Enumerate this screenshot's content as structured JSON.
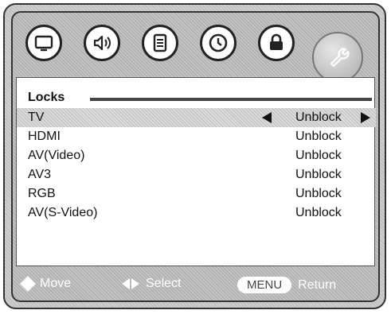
{
  "tabs": [
    {
      "name": "picture-tab",
      "icon": "tv-icon"
    },
    {
      "name": "audio-tab",
      "icon": "speaker-icon"
    },
    {
      "name": "setup-tab",
      "icon": "document-icon"
    },
    {
      "name": "time-tab",
      "icon": "clock-icon"
    },
    {
      "name": "lock-tab",
      "icon": "lock-icon"
    },
    {
      "name": "settings-tab",
      "icon": "wrench-icon",
      "active": true
    }
  ],
  "section": {
    "title": "Locks"
  },
  "rows": [
    {
      "label": "TV",
      "value": "Unblock",
      "selected": true
    },
    {
      "label": "HDMI",
      "value": "Unblock"
    },
    {
      "label": "AV(Video)",
      "value": "Unblock"
    },
    {
      "label": "AV3",
      "value": "Unblock"
    },
    {
      "label": "RGB",
      "value": "Unblock"
    },
    {
      "label": "AV(S-Video)",
      "value": "Unblock"
    }
  ],
  "footer": {
    "move_label": "Move",
    "select_label": "Select",
    "menu_label": "MENU",
    "return_label": "Return"
  }
}
